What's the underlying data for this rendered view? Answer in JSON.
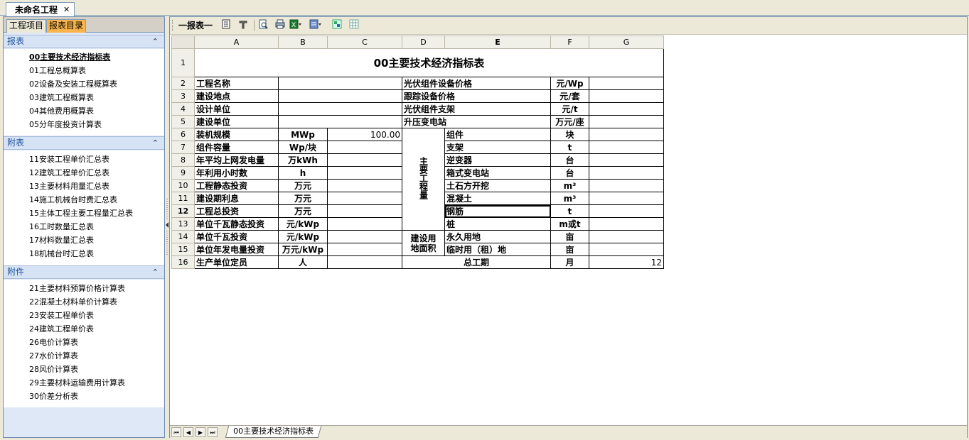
{
  "doc_tab": {
    "title": "未命名工程",
    "close": "✕"
  },
  "left_panel": {
    "tabs": [
      "工程项目",
      "报表目录"
    ],
    "sections": [
      {
        "title": "报表",
        "chev": "⌃",
        "items": [
          "00主要技术经济指标表",
          "01工程总概算表",
          "02设备及安装工程概算表",
          "03建筑工程概算表",
          "04其他费用概算表",
          "05分年度投资计算表"
        ]
      },
      {
        "title": "附表",
        "chev": "⌃",
        "items": [
          "11安装工程单价汇总表",
          "12建筑工程单价汇总表",
          "13主要材料用量汇总表",
          "14施工机械台时费汇总表",
          "15主体工程主要工程量汇总表",
          "16工时数量汇总表",
          "17材料数量汇总表",
          "18机械台时汇总表"
        ]
      },
      {
        "title": "附件",
        "chev": "⌃",
        "items": [
          "21主要材料预算价格计算表",
          "22混凝土材料单价计算表",
          "23安装工程单价表",
          "24建筑工程单价表",
          "26电价计算表",
          "27水价计算表",
          "28风价计算表",
          "29主要材料运输费用计算表",
          "30价差分析表"
        ]
      }
    ]
  },
  "toolbar": {
    "label": "一报表一",
    "icons": [
      "report-icon",
      "tools-icon",
      "preview-icon",
      "print-icon",
      "excel-export-icon",
      "export-dropdown-icon",
      "fit-icon",
      "grid-icon"
    ]
  },
  "sheet": {
    "columns": [
      "A",
      "B",
      "C",
      "D",
      "E",
      "F",
      "G"
    ],
    "rows": [
      "1",
      "2",
      "3",
      "4",
      "5",
      "6",
      "7",
      "8",
      "9",
      "10",
      "11",
      "12",
      "13",
      "14",
      "15",
      "16"
    ],
    "title": "00主要技术经济指标表",
    "a": [
      "工程名称",
      "建设地点",
      "设计单位",
      "建设单位",
      "装机规模",
      "组件容量",
      "年平均上网发电量",
      "年利用小时数",
      "工程静态投资",
      "建设期利息",
      "工程总投资",
      "单位千瓦静态投资",
      "单位千瓦投资",
      "单位年发电量投资",
      "生产单位定员"
    ],
    "b": [
      "",
      "",
      "",
      "",
      "MWp",
      "Wp/块",
      "万kWh",
      "h",
      "万元",
      "万元",
      "万元",
      "元/kWp",
      "元/kWp",
      "万元/kWp",
      "人"
    ],
    "c6": "100.00",
    "de_top": [
      "光伏组件设备价格",
      "跟踪设备价格",
      "光伏组件支架",
      "升压变电站"
    ],
    "f_top": [
      "元/Wp",
      "元/套",
      "元/t",
      "万元/座"
    ],
    "d_main_works": "主要工程量",
    "e_mid": [
      "组件",
      "支架",
      "逆变器",
      "箱式变电站",
      "土石方开挖",
      "混凝土",
      "钢筋",
      "桩",
      "永久用地",
      "临时用（租）地"
    ],
    "f_mid": [
      "块",
      "t",
      "台",
      "台",
      "m³",
      "m³",
      "t",
      "m或t",
      "亩",
      "亩"
    ],
    "d_land": "建设用地面积",
    "de16": "总工期",
    "f16": "月",
    "g16": "12"
  },
  "sheet_tabs": {
    "nav": [
      "⏮",
      "◀",
      "▶",
      "⏭"
    ],
    "active": "00主要技术经济指标表"
  }
}
